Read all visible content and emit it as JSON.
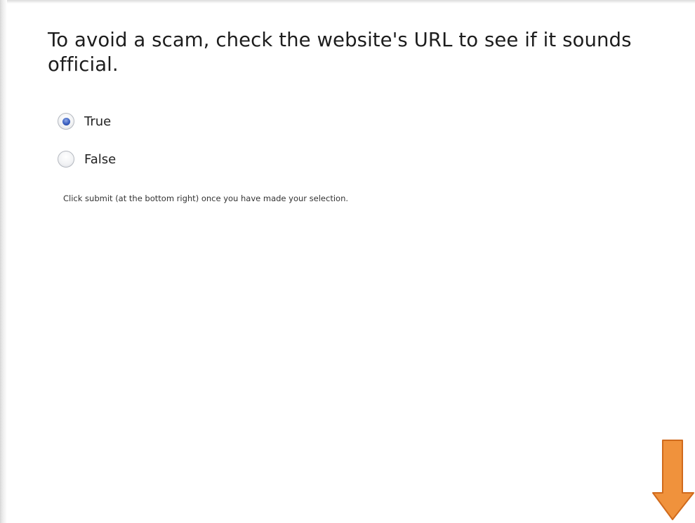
{
  "quiz": {
    "question": "To avoid a scam, check the website's URL to see if it sounds official.",
    "options": [
      {
        "label": "True",
        "selected": true
      },
      {
        "label": "False",
        "selected": false
      }
    ],
    "instruction": "Click submit (at the bottom right) once you have made your selection."
  },
  "indicator": {
    "icon": "down-arrow-icon",
    "color": "#f0923c",
    "stroke_color": "#d06a1c"
  },
  "colors": {
    "radio_selected": "#3a5fc0",
    "background": "#ffffff",
    "text": "#1d1d1d"
  }
}
